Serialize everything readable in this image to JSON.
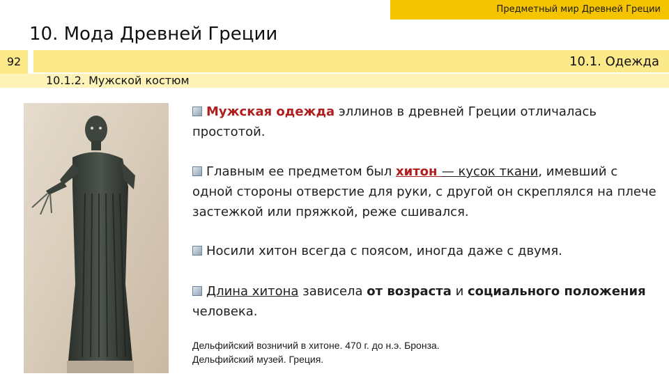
{
  "header": {
    "course_title": "Предметный мир Древней Греции"
  },
  "page": {
    "title": "10. Мода Древней Греции",
    "slide_number": "92"
  },
  "section": {
    "title": "10.1. Одежда",
    "subtitle": "10.1.2. Мужской костюм"
  },
  "content": {
    "p1": {
      "lead": "Мужская одежда",
      "rest": " эллинов в древней Греции отличалась простотой."
    },
    "p2": {
      "a": "Главным ее предметом был ",
      "hiton": "хитон ",
      "dash": "— ",
      "cloth": "кусок ткани",
      "rest": ", имевший с одной стороны отверстие для руки, с другой он скреплялся на плече застежкой или пряжкой, реже сшивался."
    },
    "p3": {
      "text": "Носили хитон всегда с поясом, иногда даже с двумя."
    },
    "p4": {
      "a": "Длина хитона",
      "b": " зависела ",
      "c": "от возраста",
      "d": " и ",
      "e": "социального положения",
      "f": " человека."
    }
  },
  "image": {
    "caption": "Дельфийский возничий в хитоне. 470 г. до н.э. Бронза. Дельфийский музей. Греция."
  },
  "colors": {
    "accent_yellow": "#f5c400",
    "band_yellow": "#fbe98a",
    "highlight_red": "#b01e1e"
  }
}
